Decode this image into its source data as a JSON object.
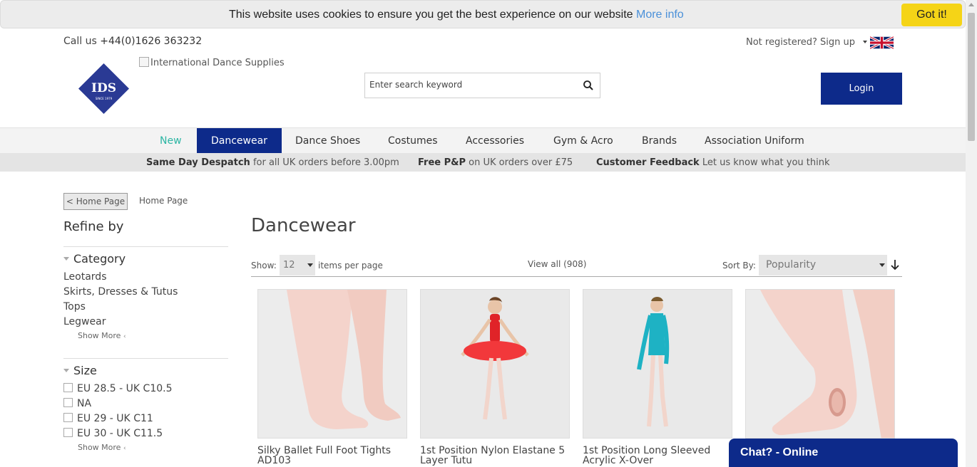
{
  "cookie": {
    "text": "This website uses cookies to ensure you get the best experience on our website",
    "more_info": "More info",
    "accept": "Got it!"
  },
  "header": {
    "call_label": "Call us",
    "phone": "+44(0)1626 363232",
    "signup": "Not registered? Sign up",
    "logo_alt": "International Dance Supplies",
    "logo_text": "IDS",
    "logo_since": "SINCE 1979",
    "search_placeholder": "Enter search keyword",
    "login": "Login"
  },
  "nav": {
    "items": [
      "New",
      "Dancewear",
      "Dance Shoes",
      "Costumes",
      "Accessories",
      "Gym & Acro",
      "Brands",
      "Association Uniform"
    ],
    "active": "Dancewear"
  },
  "promo": [
    {
      "bold": "Same Day Despatch",
      "text": "for all UK orders before 3.00pm"
    },
    {
      "bold": "Free P&P",
      "text": "on UK orders over £75"
    },
    {
      "bold": "Customer Feedback",
      "text": "Let us know what you think"
    }
  ],
  "sidebar": {
    "back": "< Home Page",
    "breadcrumb": "Home Page",
    "refine": "Refine by",
    "category_title": "Category",
    "categories": [
      "Leotards",
      "Skirts, Dresses & Tutus",
      "Tops",
      "Legwear"
    ],
    "show_more": "Show More",
    "size_title": "Size",
    "sizes": [
      "EU 28.5 - UK C10.5",
      "NA",
      "EU 29 - UK C11",
      "EU 30 - UK C11.5"
    ]
  },
  "main": {
    "title": "Dancewear",
    "show_label": "Show:",
    "per_page": "12",
    "items_label": "items per page",
    "view_all": "View all (908)",
    "sort_label": "Sort By:",
    "sort_value": "Popularity"
  },
  "products": [
    {
      "name": "Silky Ballet Full Foot Tights AD103"
    },
    {
      "name": "1st Position Nylon Elastane 5 Layer Tutu"
    },
    {
      "name": "1st Position Long Sleeved Acrylic X-Over"
    },
    {
      "name": ""
    }
  ],
  "chat": "Chat? - Online",
  "colors": {
    "brand_blue": "#0d2a8a",
    "accent_teal": "#2bb5a3",
    "cookie_yellow": "#f5d417"
  }
}
